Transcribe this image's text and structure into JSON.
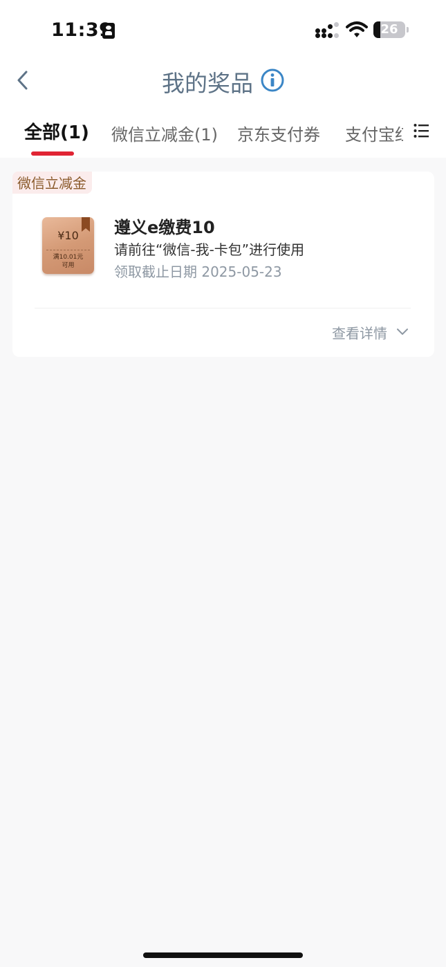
{
  "status_bar": {
    "time": "11:39",
    "battery_level": "26"
  },
  "header": {
    "back_icon": "chevron-left-icon",
    "title": "我的奖品",
    "info_icon": "info-icon",
    "title_color": "#5e7387",
    "info_color": "#3b86c6"
  },
  "tabs": {
    "items": [
      {
        "label": "全部(1)",
        "active": true
      },
      {
        "label": "微信立减金(1)",
        "active": false
      },
      {
        "label": "京东支付券",
        "active": false
      },
      {
        "label": "支付宝红包",
        "active": false
      }
    ],
    "indicator_color": "#e02433",
    "menu_icon": "list-icon"
  },
  "prizes": [
    {
      "category_tag": "微信立减金",
      "coupon": {
        "amount": "¥10",
        "condition_line1": "满10.01元",
        "condition_line2": "可用"
      },
      "name": "遵义e缴费10",
      "usage": "请前往“微信-我-卡包”进行使用",
      "deadline": "领取截止日期 2025-05-23",
      "details_label": "查看详情"
    }
  ]
}
